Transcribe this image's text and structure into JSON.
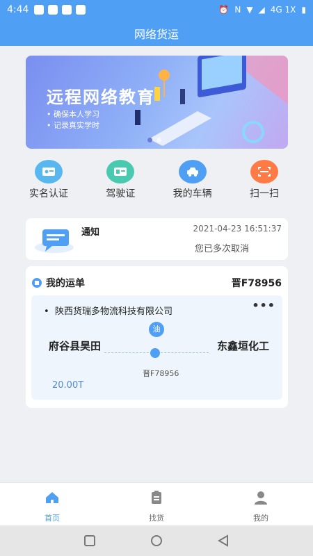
{
  "status_bar": {
    "time": "4:44",
    "network": "4G 1X"
  },
  "header": {
    "title": "网络货运"
  },
  "banner": {
    "headline": "远程网络教育",
    "bullets": [
      "• 确保本人学习",
      "• 记录真实学时"
    ]
  },
  "quick_menu": [
    {
      "label": "实名认证",
      "icon": "id-card-icon",
      "color": "#59b7f0"
    },
    {
      "label": "驾驶证",
      "icon": "license-icon",
      "color": "#48c9b0"
    },
    {
      "label": "我的车辆",
      "icon": "car-icon",
      "color": "#4f9ff4"
    },
    {
      "label": "扫一扫",
      "icon": "scan-icon",
      "color": "#ff7a45"
    }
  ],
  "notice": {
    "label": "通知",
    "time": "2021-04-23 16:51:37",
    "message": "您已多次取消"
  },
  "orders": {
    "title": "我的运单",
    "plate": "晋F78956",
    "item": {
      "company": "陕西货瑞多物流科技有限公司",
      "more": "•••",
      "fuel_badge": "油",
      "from": "府谷县昊田",
      "to": "东鑫垣化工",
      "plate": "晋F78956",
      "weight": "20.00T"
    }
  },
  "bottom_nav": [
    {
      "label": "首页",
      "icon": "home-icon",
      "active": true
    },
    {
      "label": "找货",
      "icon": "clipboard-icon",
      "active": false
    },
    {
      "label": "我的",
      "icon": "user-icon",
      "active": false
    }
  ],
  "colors": {
    "primary": "#4f9ff4",
    "background": "#eef0f3"
  }
}
